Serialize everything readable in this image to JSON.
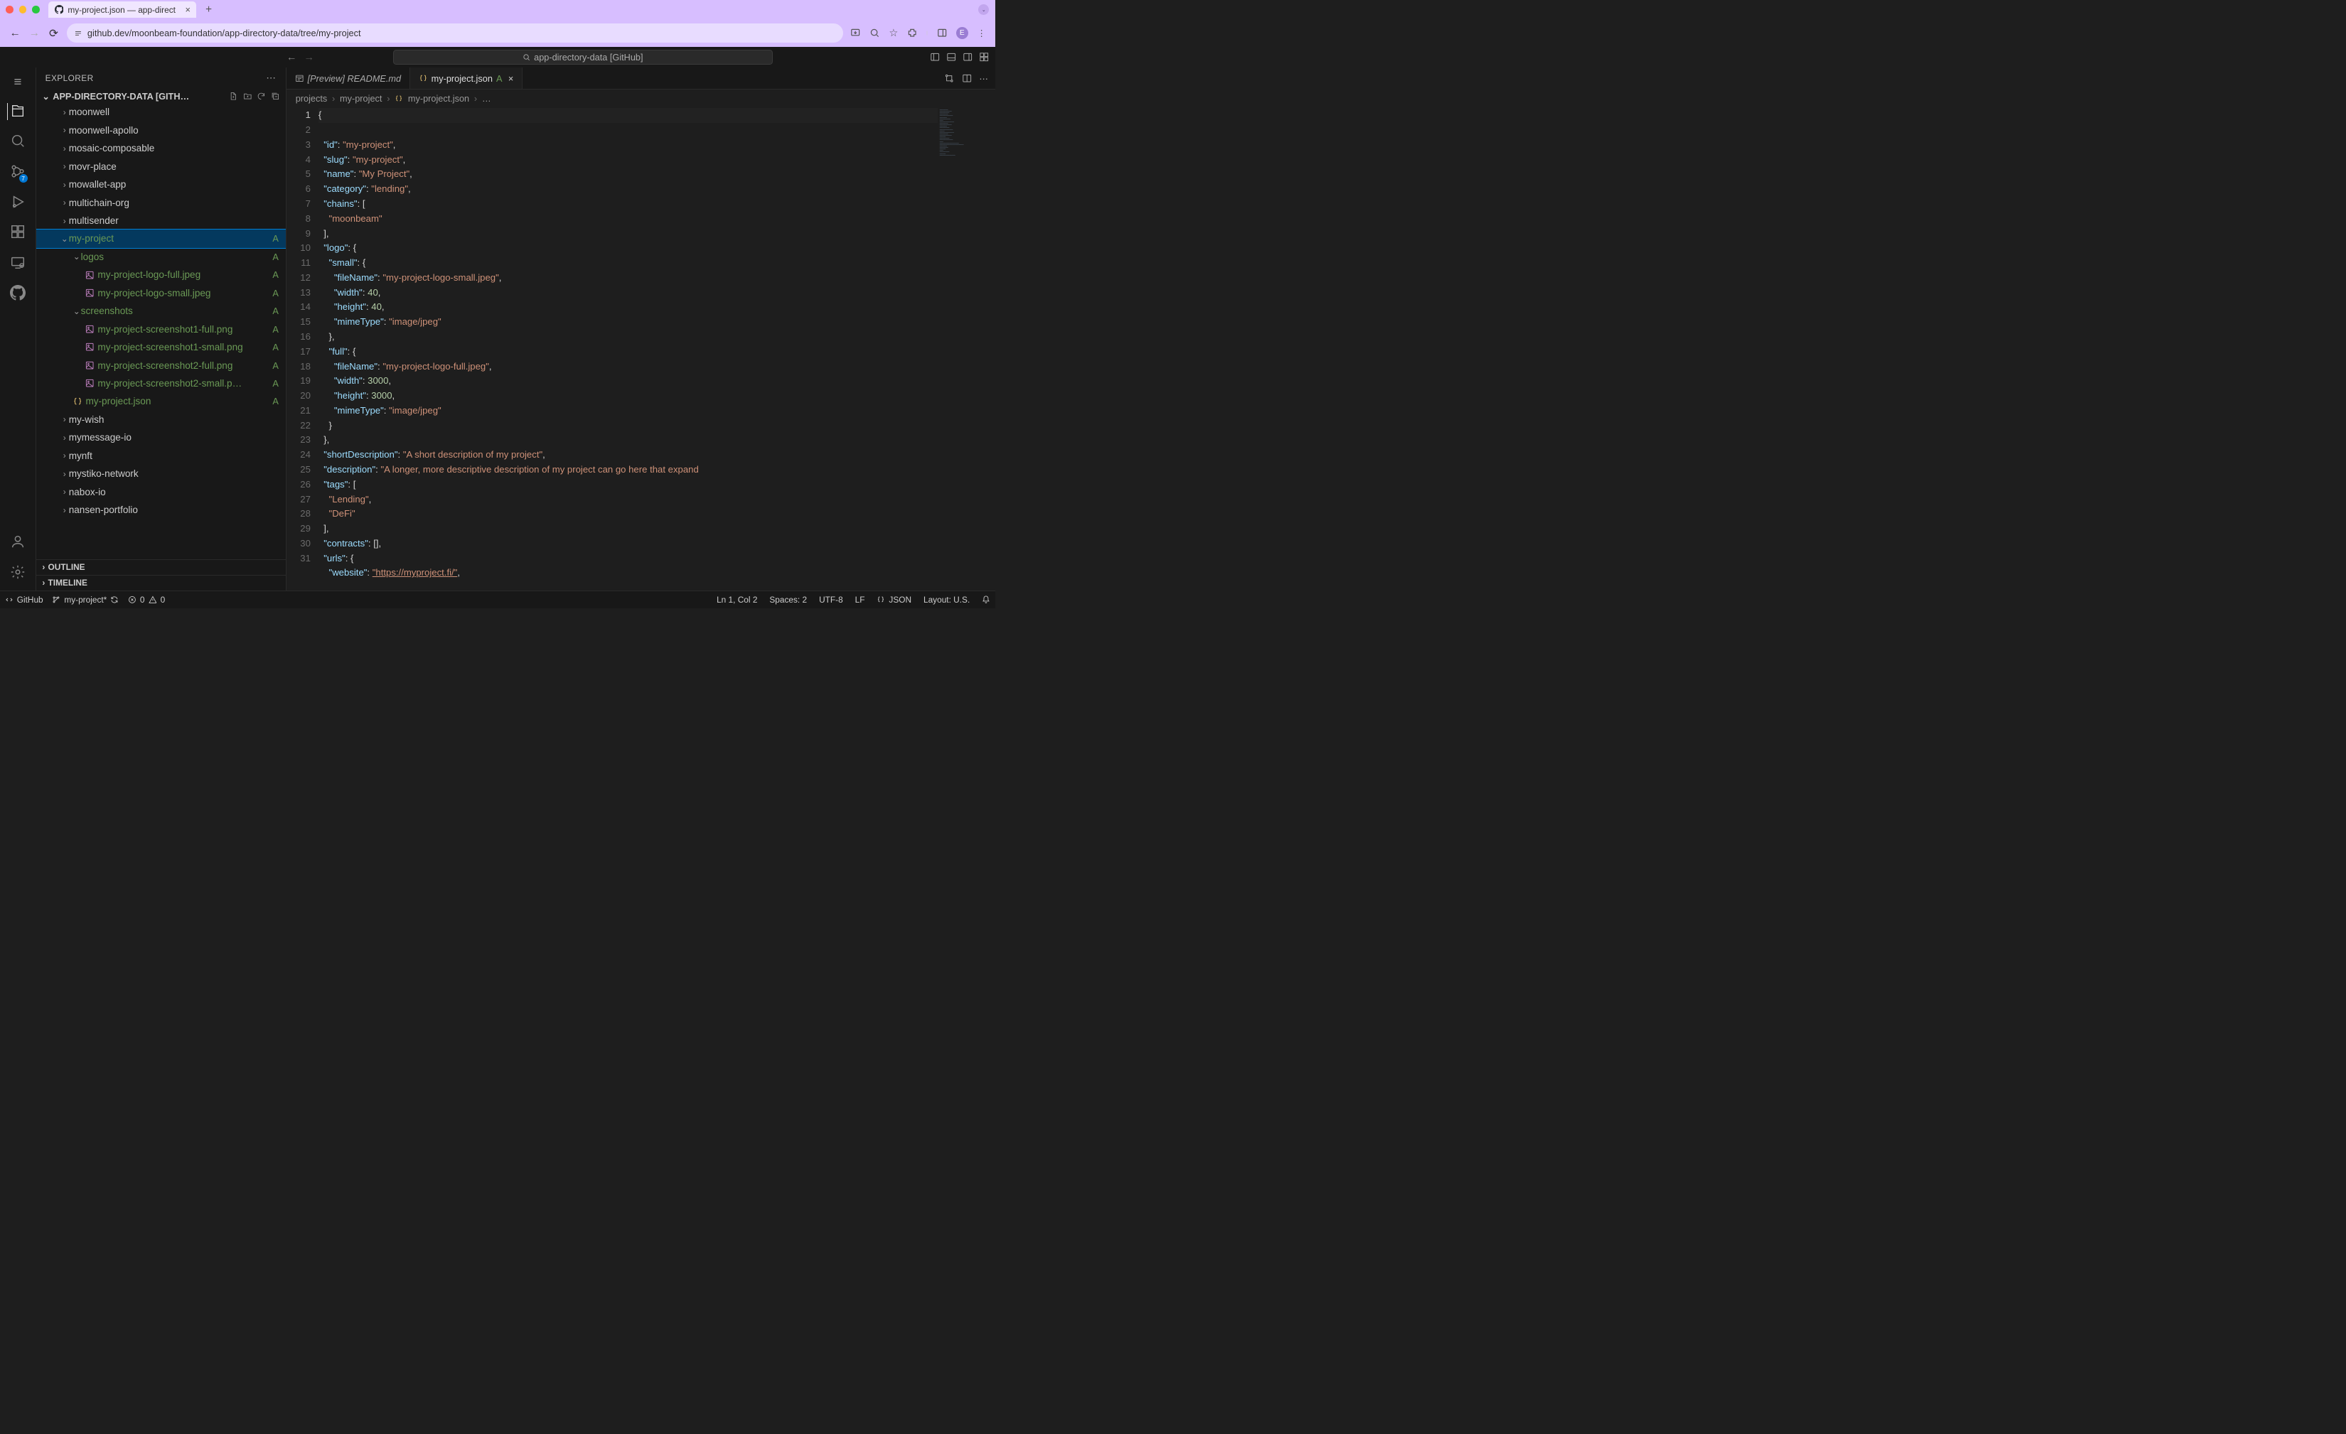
{
  "browser": {
    "tab_title": "my-project.json — app-direct",
    "url": "github.dev/moonbeam-foundation/app-directory-data/tree/my-project",
    "avatar_letter": "E"
  },
  "command_center": "app-directory-data [GitHub]",
  "explorer": {
    "title": "EXPLORER",
    "repo_label": "APP-DIRECTORY-DATA [GITH…",
    "outline": "OUTLINE",
    "timeline": "TIMELINE"
  },
  "tree": {
    "moonwell": "moonwell",
    "moonwell_apollo": "moonwell-apollo",
    "mosaic": "mosaic-composable",
    "movr": "movr-place",
    "mowallet": "mowallet-app",
    "multichain": "multichain-org",
    "multisender": "multisender",
    "my_project": "my-project",
    "logos": "logos",
    "logo_full": "my-project-logo-full.jpeg",
    "logo_small": "my-project-logo-small.jpeg",
    "screenshots": "screenshots",
    "ss1f": "my-project-screenshot1-full.png",
    "ss1s": "my-project-screenshot1-small.png",
    "ss2f": "my-project-screenshot2-full.png",
    "ss2s": "my-project-screenshot2-small.p…",
    "json_file": "my-project.json",
    "my_wish": "my-wish",
    "mymessage": "mymessage-io",
    "mynft": "mynft",
    "mystiko": "mystiko-network",
    "nabox": "nabox-io",
    "nansen": "nansen-portfolio",
    "badge_a": "A"
  },
  "tabs": {
    "preview": "[Preview] README.md",
    "json": "my-project.json",
    "a": "A"
  },
  "breadcrumbs": {
    "projects": "projects",
    "my_project": "my-project",
    "file": "my-project.json",
    "dots": "…"
  },
  "code": {
    "l1": "{",
    "l2_k": "\"id\"",
    "l2_v": "\"my-project\"",
    "l3_k": "\"slug\"",
    "l3_v": "\"my-project\"",
    "l4_k": "\"name\"",
    "l4_v": "\"My Project\"",
    "l5_k": "\"category\"",
    "l5_v": "\"lending\"",
    "l6_k": "\"chains\"",
    "l7_v": "\"moonbeam\"",
    "l9_k": "\"logo\"",
    "l10_k": "\"small\"",
    "l11_k": "\"fileName\"",
    "l11_v": "\"my-project-logo-small.jpeg\"",
    "l12_k": "\"width\"",
    "l12_v": "40",
    "l13_k": "\"height\"",
    "l13_v": "40",
    "l14_k": "\"mimeType\"",
    "l14_v": "\"image/jpeg\"",
    "l16_k": "\"full\"",
    "l17_k": "\"fileName\"",
    "l17_v": "\"my-project-logo-full.jpeg\"",
    "l18_k": "\"width\"",
    "l18_v": "3000",
    "l19_k": "\"height\"",
    "l19_v": "3000",
    "l20_k": "\"mimeType\"",
    "l20_v": "\"image/jpeg\"",
    "l23_k": "\"shortDescription\"",
    "l23_v": "\"A short description of my project\"",
    "l24_k": "\"description\"",
    "l24_v": "\"A longer, more descriptive description of my project can go here that expand",
    "l25_k": "\"tags\"",
    "l26_v": "\"Lending\"",
    "l27_v": "\"DeFi\"",
    "l29_k": "\"contracts\"",
    "l30_k": "\"urls\"",
    "l31_k": "\"website\"",
    "l31_v": "\"https://myproject.fi/\""
  },
  "status": {
    "github": "GitHub",
    "branch": "my-project*",
    "errors": "0",
    "warnings": "0",
    "lncol": "Ln 1, Col 2",
    "spaces": "Spaces: 2",
    "encoding": "UTF-8",
    "eol": "LF",
    "lang": "JSON",
    "layout": "Layout: U.S."
  },
  "scm_badge": "7"
}
